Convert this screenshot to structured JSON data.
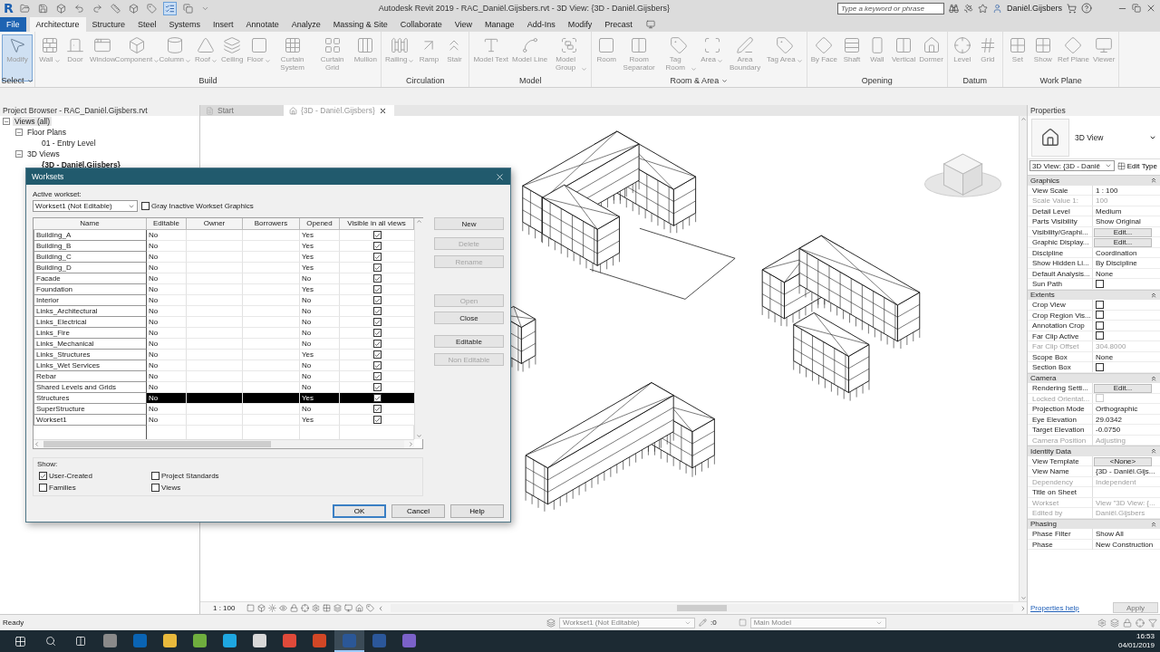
{
  "titlebar": {
    "app_logo": "R",
    "title": "Autodesk Revit 2019 - RAC_Daniël.Gijsbers.rvt - 3D View: {3D - Daniël.Gijsbers}",
    "search": {
      "placeholder": "Type a keyword or phrase"
    },
    "user": "Daniël.Gijsbers"
  },
  "ribbon_tabs": [
    {
      "label": "File",
      "kind": "file",
      "selected": false
    },
    {
      "label": "Architecture",
      "kind": "tab",
      "selected": true
    },
    {
      "label": "Structure",
      "kind": "tab",
      "selected": false
    },
    {
      "label": "Steel",
      "kind": "tab",
      "selected": false
    },
    {
      "label": "Systems",
      "kind": "tab",
      "selected": false
    },
    {
      "label": "Insert",
      "kind": "tab",
      "selected": false
    },
    {
      "label": "Annotate",
      "kind": "tab",
      "selected": false
    },
    {
      "label": "Analyze",
      "kind": "tab",
      "selected": false
    },
    {
      "label": "Massing & Site",
      "kind": "tab",
      "selected": false
    },
    {
      "label": "Collaborate",
      "kind": "tab",
      "selected": false
    },
    {
      "label": "View",
      "kind": "tab",
      "selected": false
    },
    {
      "label": "Manage",
      "kind": "tab",
      "selected": false
    },
    {
      "label": "Add-Ins",
      "kind": "tab",
      "selected": false
    },
    {
      "label": "Modify",
      "kind": "tab",
      "selected": false
    },
    {
      "label": "Precast",
      "kind": "tab",
      "selected": false
    }
  ],
  "ribbon_panels": [
    {
      "label": "Select",
      "dropdown": true,
      "tools": [
        {
          "label": "Modify",
          "selected": true,
          "dropdown": false
        }
      ]
    },
    {
      "label": "Build",
      "dropdown": false,
      "tools": [
        {
          "label": "Wall",
          "selected": false,
          "dropdown": true
        },
        {
          "label": "Door",
          "selected": false,
          "dropdown": false
        },
        {
          "label": "Window",
          "selected": false,
          "dropdown": false
        },
        {
          "label": "Component",
          "selected": false,
          "dropdown": true
        },
        {
          "label": "Column",
          "selected": false,
          "dropdown": true
        },
        {
          "label": "Roof",
          "selected": false,
          "dropdown": true
        },
        {
          "label": "Ceiling",
          "selected": false,
          "dropdown": false
        },
        {
          "label": "Floor",
          "selected": false,
          "dropdown": true
        },
        {
          "label": "Curtain System",
          "selected": false,
          "dropdown": false
        },
        {
          "label": "Curtain Grid",
          "selected": false,
          "dropdown": false
        },
        {
          "label": "Mullion",
          "selected": false,
          "dropdown": false
        }
      ]
    },
    {
      "label": "Circulation",
      "dropdown": false,
      "tools": [
        {
          "label": "Railing",
          "selected": false,
          "dropdown": true
        },
        {
          "label": "Ramp",
          "selected": false,
          "dropdown": false
        },
        {
          "label": "Stair",
          "selected": false,
          "dropdown": false
        }
      ]
    },
    {
      "label": "Model",
      "dropdown": false,
      "tools": [
        {
          "label": "Model Text",
          "selected": false,
          "dropdown": false
        },
        {
          "label": "Model Line",
          "selected": false,
          "dropdown": false
        },
        {
          "label": "Model Group",
          "selected": false,
          "dropdown": true
        }
      ]
    },
    {
      "label": "Room & Area",
      "dropdown": true,
      "tools": [
        {
          "label": "Room",
          "selected": false,
          "dropdown": false
        },
        {
          "label": "Room Separator",
          "selected": false,
          "dropdown": false
        },
        {
          "label": "Tag Room",
          "selected": false,
          "dropdown": true
        },
        {
          "label": "Area",
          "selected": false,
          "dropdown": true
        },
        {
          "label": "Area Boundary",
          "selected": false,
          "dropdown": false
        },
        {
          "label": "Tag Area",
          "selected": false,
          "dropdown": true
        }
      ]
    },
    {
      "label": "Opening",
      "dropdown": false,
      "tools": [
        {
          "label": "By Face",
          "selected": false,
          "dropdown": false
        },
        {
          "label": "Shaft",
          "selected": false,
          "dropdown": false
        },
        {
          "label": "Wall",
          "selected": false,
          "dropdown": false
        },
        {
          "label": "Vertical",
          "selected": false,
          "dropdown": false
        },
        {
          "label": "Dormer",
          "selected": false,
          "dropdown": false
        }
      ]
    },
    {
      "label": "Datum",
      "dropdown": false,
      "tools": [
        {
          "label": "Level",
          "selected": false,
          "dropdown": false
        },
        {
          "label": "Grid",
          "selected": false,
          "dropdown": false
        }
      ]
    },
    {
      "label": "Work Plane",
      "dropdown": false,
      "tools": [
        {
          "label": "Set",
          "selected": false,
          "dropdown": false
        },
        {
          "label": "Show",
          "selected": false,
          "dropdown": false
        },
        {
          "label": "Ref Plane",
          "selected": false,
          "dropdown": false
        },
        {
          "label": "Viewer",
          "selected": false,
          "dropdown": false
        }
      ]
    }
  ],
  "browser": {
    "title": "Project Browser - RAC_Daniël.Gijsbers.rvt",
    "tree": [
      {
        "label": "Views (all)",
        "expanded": true,
        "children": [
          {
            "label": "Floor Plans",
            "expanded": true,
            "children": [
              {
                "label": "01 - Entry Level",
                "current": false
              }
            ]
          },
          {
            "label": "3D Views",
            "expanded": true,
            "children": [
              {
                "label": "{3D - Daniël.Gijsbers}",
                "current": true
              }
            ]
          }
        ]
      }
    ]
  },
  "view_tabs": [
    {
      "label": "Start",
      "selected": false,
      "closable": false
    },
    {
      "label": "{3D - Daniël.Gijsbers}",
      "selected": true,
      "closable": true
    }
  ],
  "view_control": {
    "scale": "1 : 100"
  },
  "properties": {
    "title": "Properties",
    "type_name": "3D View",
    "instance_selector": "3D View: {3D - Danië",
    "edit_type": "Edit Type",
    "sections": [
      {
        "title": "Graphics",
        "expanded": true,
        "rows": [
          {
            "kind": "text",
            "label": "View Scale",
            "value": "1 : 100",
            "disabled": false
          },
          {
            "kind": "text",
            "label": "Scale Value    1:",
            "value": "100",
            "disabled": true
          },
          {
            "kind": "text",
            "label": "Detail Level",
            "value": "Medium",
            "disabled": false
          },
          {
            "kind": "text",
            "label": "Parts Visibility",
            "value": "Show Original",
            "disabled": false
          },
          {
            "kind": "button",
            "label": "Visibility/Graphi...",
            "value": "Edit...",
            "disabled": false
          },
          {
            "kind": "button",
            "label": "Graphic Display...",
            "value": "Edit...",
            "disabled": false
          },
          {
            "kind": "text",
            "label": "Discipline",
            "value": "Coordination",
            "disabled": false
          },
          {
            "kind": "text",
            "label": "Show Hidden Li...",
            "value": "By Discipline",
            "disabled": false
          },
          {
            "kind": "text",
            "label": "Default Analysis...",
            "value": "None",
            "disabled": false
          },
          {
            "kind": "check",
            "label": "Sun Path",
            "checked": false,
            "disabled": false
          }
        ]
      },
      {
        "title": "Extents",
        "expanded": true,
        "rows": [
          {
            "kind": "check",
            "label": "Crop View",
            "checked": false,
            "disabled": false
          },
          {
            "kind": "check",
            "label": "Crop Region Vis...",
            "checked": false,
            "disabled": false
          },
          {
            "kind": "check",
            "label": "Annotation Crop",
            "checked": false,
            "disabled": false
          },
          {
            "kind": "check",
            "label": "Far Clip Active",
            "checked": false,
            "disabled": false
          },
          {
            "kind": "text",
            "label": "Far Clip Offset",
            "value": "304.8000",
            "disabled": true
          },
          {
            "kind": "text",
            "label": "Scope Box",
            "value": "None",
            "disabled": false
          },
          {
            "kind": "check",
            "label": "Section Box",
            "checked": false,
            "disabled": false
          }
        ]
      },
      {
        "title": "Camera",
        "expanded": true,
        "rows": [
          {
            "kind": "button",
            "label": "Rendering Setti...",
            "value": "Edit...",
            "disabled": false
          },
          {
            "kind": "check",
            "label": "Locked Orientat...",
            "checked": false,
            "disabled": true
          },
          {
            "kind": "text",
            "label": "Projection Mode",
            "value": "Orthographic",
            "disabled": false
          },
          {
            "kind": "text",
            "label": "Eye Elevation",
            "value": "29.0342",
            "disabled": false
          },
          {
            "kind": "text",
            "label": "Target Elevation",
            "value": "-0.0750",
            "disabled": false
          },
          {
            "kind": "text",
            "label": "Camera Position",
            "value": "Adjusting",
            "disabled": true
          }
        ]
      },
      {
        "title": "Identity Data",
        "expanded": true,
        "rows": [
          {
            "kind": "button",
            "label": "View Template",
            "value": "<None>",
            "disabled": false
          },
          {
            "kind": "text",
            "label": "View Name",
            "value": "{3D - Daniël.Gijs...",
            "disabled": false
          },
          {
            "kind": "text",
            "label": "Dependency",
            "value": "Independent",
            "disabled": true
          },
          {
            "kind": "text",
            "label": "Title on Sheet",
            "disabled": false
          },
          {
            "kind": "text",
            "label": "Workset",
            "value": "View \"3D View: {...",
            "disabled": true
          },
          {
            "kind": "text",
            "label": "Edited by",
            "value": "Daniël.Gijsbers",
            "disabled": true
          }
        ]
      },
      {
        "title": "Phasing",
        "expanded": true,
        "rows": [
          {
            "kind": "text",
            "label": "Phase Filter",
            "value": "Show All",
            "disabled": false
          },
          {
            "kind": "text",
            "label": "Phase",
            "value": "New Construction",
            "disabled": false
          }
        ]
      }
    ],
    "help_link": "Properties help",
    "apply": {
      "label": "Apply",
      "disabled": true
    }
  },
  "worksets_dialog": {
    "title": "Worksets",
    "active_label": "Active workset:",
    "active_workset": "Workset1 (Not Editable)",
    "gray_inactive": {
      "label": "Gray Inactive Workset Graphics",
      "checked": false
    },
    "columns": [
      "Name",
      "Editable",
      "Owner",
      "Borrowers",
      "Opened",
      "Visible in all views"
    ],
    "rows": [
      {
        "name": "Building_A",
        "editable": "No",
        "opened": "Yes",
        "visible": true,
        "selected": false
      },
      {
        "name": "Building_B",
        "editable": "No",
        "opened": "Yes",
        "visible": true,
        "selected": false
      },
      {
        "name": "Building_C",
        "editable": "No",
        "opened": "Yes",
        "visible": true,
        "selected": false
      },
      {
        "name": "Building_D",
        "editable": "No",
        "opened": "Yes",
        "visible": true,
        "selected": false
      },
      {
        "name": "Facade",
        "editable": "No",
        "opened": "No",
        "visible": true,
        "selected": false
      },
      {
        "name": "Foundation",
        "editable": "No",
        "opened": "Yes",
        "visible": true,
        "selected": false
      },
      {
        "name": "Interior",
        "editable": "No",
        "opened": "No",
        "visible": true,
        "selected": false
      },
      {
        "name": "Links_Architectural",
        "editable": "No",
        "opened": "No",
        "visible": true,
        "selected": false
      },
      {
        "name": "Links_Electrical",
        "editable": "No",
        "opened": "No",
        "visible": true,
        "selected": false
      },
      {
        "name": "Links_Fire",
        "editable": "No",
        "opened": "No",
        "visible": true,
        "selected": false
      },
      {
        "name": "Links_Mechanical",
        "editable": "No",
        "opened": "No",
        "visible": true,
        "selected": false
      },
      {
        "name": "Links_Structures",
        "editable": "No",
        "opened": "Yes",
        "visible": true,
        "selected": false
      },
      {
        "name": "Links_Wet Services",
        "editable": "No",
        "opened": "No",
        "visible": true,
        "selected": false
      },
      {
        "name": "Rebar",
        "editable": "No",
        "opened": "No",
        "visible": true,
        "selected": false
      },
      {
        "name": "Shared Levels and Grids",
        "editable": "No",
        "opened": "No",
        "visible": true,
        "selected": false
      },
      {
        "name": "Structures",
        "editable": "No",
        "opened": "Yes",
        "visible": true,
        "selected": true
      },
      {
        "name": "SuperStructure",
        "editable": "No",
        "opened": "No",
        "visible": true,
        "selected": false
      },
      {
        "name": "Workset1",
        "editable": "No",
        "opened": "Yes",
        "visible": true,
        "selected": false
      }
    ],
    "side_buttons": [
      {
        "label": "New",
        "disabled": false
      },
      {
        "label": "Delete",
        "disabled": true
      },
      {
        "label": "Rename",
        "disabled": true
      },
      {
        "label": "Open",
        "disabled": true
      },
      {
        "label": "Close",
        "disabled": false
      },
      {
        "label": "Editable",
        "disabled": false
      },
      {
        "label": "Non Editable",
        "disabled": true
      }
    ],
    "show_label": "Show:",
    "show_options": [
      {
        "label": "User-Created",
        "checked": true
      },
      {
        "label": "Project Standards",
        "checked": false
      },
      {
        "label": "Families",
        "checked": false
      },
      {
        "label": "Views",
        "checked": false
      }
    ],
    "footer_buttons": [
      {
        "label": "OK",
        "default": true
      },
      {
        "label": "Cancel",
        "default": false
      },
      {
        "label": "Help",
        "default": false
      }
    ]
  },
  "status_bar": {
    "message": "Ready",
    "workset": "Workset1 (Not Editable)",
    "editable_count": ":0",
    "design_option": "Main Model"
  },
  "taskbar": {
    "apps": [
      {
        "color": "#8a8a8a",
        "active": false
      },
      {
        "color": "#0a64b4",
        "active": false
      },
      {
        "color": "#e8b93c",
        "active": false
      },
      {
        "color": "#6fae3e",
        "active": false
      },
      {
        "color": "#1ea7e1",
        "active": false
      },
      {
        "color": "#d8d8d8",
        "active": false
      },
      {
        "color": "#e04a3a",
        "active": false
      },
      {
        "color": "#d24726",
        "active": false
      },
      {
        "color": "#2b5797",
        "active": true
      },
      {
        "color": "#2b579a",
        "active": false
      },
      {
        "color": "#7b62c9",
        "active": false
      }
    ],
    "time": "16:53",
    "date": "04/01/2019"
  }
}
